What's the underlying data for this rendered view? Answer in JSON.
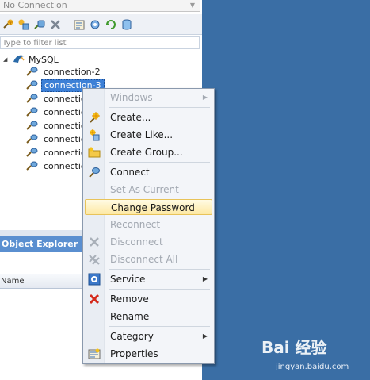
{
  "connection_dropdown": {
    "value": "No Connection"
  },
  "toolbar": {
    "icons": [
      "new-connection-icon",
      "new-connection-like-icon",
      "connect-icon",
      "disconnect-icon",
      "properties-icon",
      "service-icon",
      "refresh-icon",
      "database-icon"
    ]
  },
  "filter": {
    "placeholder": "Type to filter list"
  },
  "tree": {
    "root_label": "MySQL",
    "items": [
      {
        "label": "connection-2"
      },
      {
        "label": "connection-3",
        "selected": true
      },
      {
        "label": "connection"
      },
      {
        "label": "connection"
      },
      {
        "label": "connection"
      },
      {
        "label": "connection"
      },
      {
        "label": "connection"
      },
      {
        "label": "connection"
      }
    ]
  },
  "object_explorer": {
    "title": "Object Explorer",
    "column_name": "Name"
  },
  "context_menu": {
    "items": [
      {
        "label": "Windows",
        "enabled": false,
        "submenu": true,
        "icon": ""
      },
      {
        "label": "Create...",
        "enabled": true,
        "icon": "create-icon"
      },
      {
        "label": "Create Like...",
        "enabled": true,
        "icon": "create-like-icon"
      },
      {
        "label": "Create Group...",
        "enabled": true,
        "icon": "folder-icon"
      },
      {
        "label": "Connect",
        "enabled": true,
        "icon": "connect-icon"
      },
      {
        "label": "Set As Current",
        "enabled": false,
        "icon": ""
      },
      {
        "label": "Change Password",
        "enabled": true,
        "highlighted": true,
        "icon": ""
      },
      {
        "label": "Reconnect",
        "enabled": false,
        "icon": ""
      },
      {
        "label": "Disconnect",
        "enabled": false,
        "icon": "disconnect-icon"
      },
      {
        "label": "Disconnect All",
        "enabled": false,
        "icon": "disconnect-all-icon"
      },
      {
        "label": "Service",
        "enabled": true,
        "submenu": true,
        "icon": "service-icon"
      },
      {
        "label": "Remove",
        "enabled": true,
        "icon": "remove-icon"
      },
      {
        "label": "Rename",
        "enabled": true,
        "icon": ""
      },
      {
        "label": "Category",
        "enabled": true,
        "submenu": true,
        "icon": ""
      },
      {
        "label": "Properties",
        "enabled": true,
        "icon": "properties-icon"
      }
    ]
  },
  "watermark": {
    "brand": "Bai 经验",
    "url": "jingyan.baidu.com"
  },
  "colors": {
    "desktop": "#3a6ea5",
    "selection": "#3d80d6",
    "highlight": "#fde9a4",
    "panel_header": "#5a8fd0"
  }
}
